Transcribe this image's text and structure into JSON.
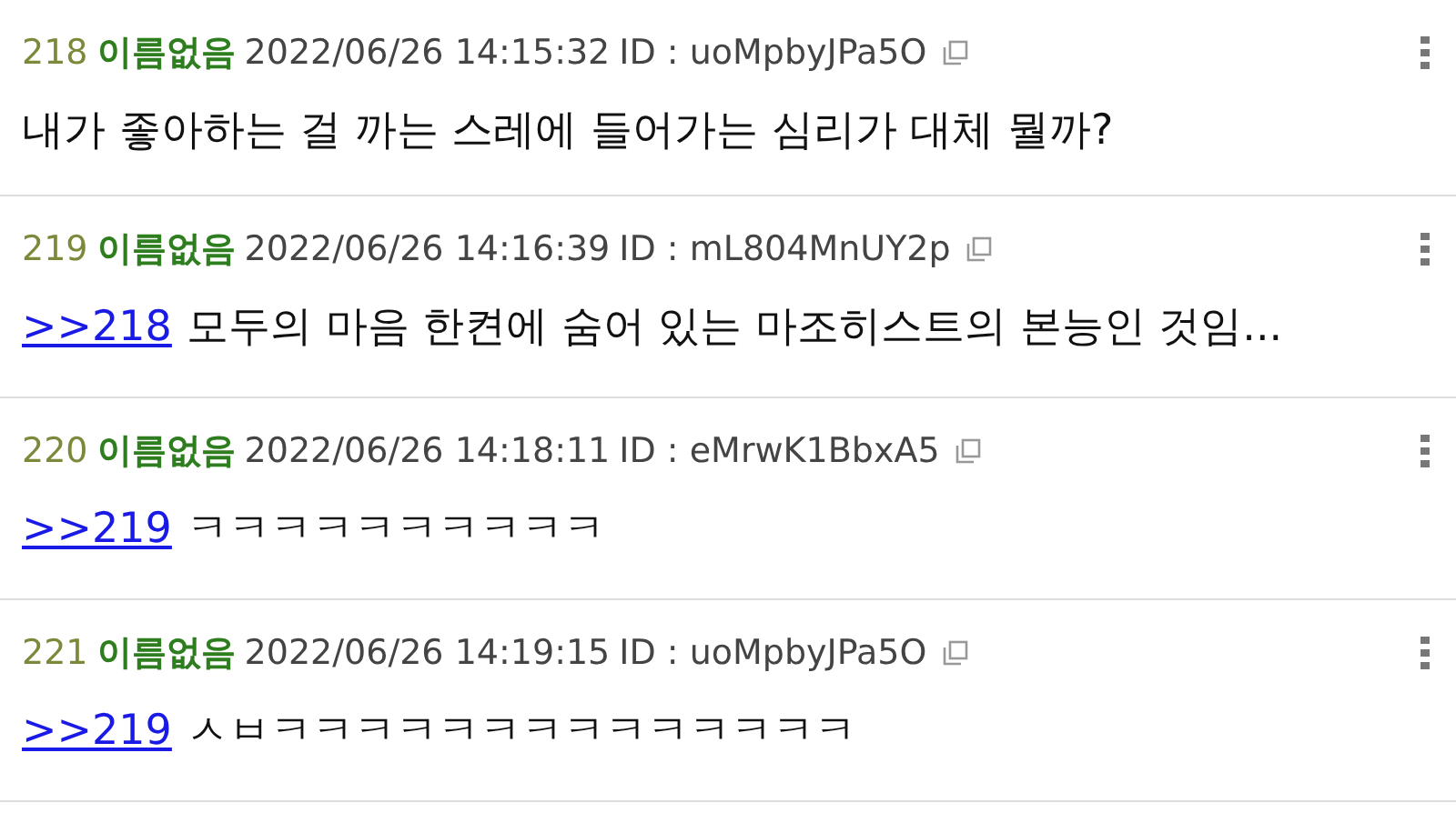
{
  "posts": [
    {
      "number": "218",
      "name": "이름없음",
      "datetime": "2022/06/26 14:15:32",
      "id": "ID : uoMpbyJPa5O",
      "text": "내가 좋아하는 걸 까는 스레에 들어가는 심리가 대체 뭘까?"
    },
    {
      "number": "219",
      "name": "이름없음",
      "datetime": "2022/06/26 14:16:39",
      "id": "ID : mL804MnUY2p",
      "reply_to": ">>218",
      "text": "모두의 마음 한켠에 숨어 있는 마조히스트의 본능인 것임..."
    },
    {
      "number": "220",
      "name": "이름없음",
      "datetime": "2022/06/26 14:18:11",
      "id": "ID : eMrwK1BbxA5",
      "reply_to": ">>219",
      "text": "ㅋㅋㅋㅋㅋㅋㅋㅋㅋㅋ"
    },
    {
      "number": "221",
      "name": "이름없음",
      "datetime": "2022/06/26 14:19:15",
      "id": "ID : uoMpbyJPa5O",
      "reply_to": ">>219",
      "text": "ㅅㅂㅋㅋㅋㅋㅋㅋㅋㅋㅋㅋㅋㅋㅋㅋ"
    }
  ]
}
